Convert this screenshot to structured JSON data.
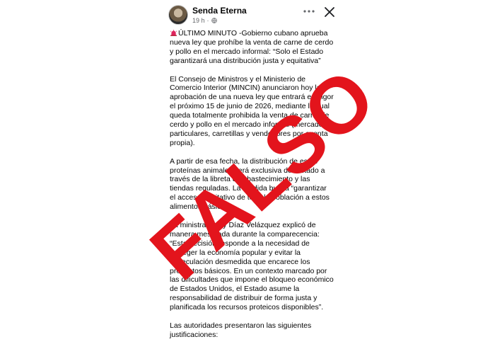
{
  "post": {
    "author": "Senda Eterna",
    "time": "19 h",
    "separator": "·",
    "headline_prefix": "🚨",
    "paragraphs": [
      "ÚLTIMO MINUTO -Gobierno cubano aprueba nueva ley que prohíbe la venta de carne de cerdo y pollo en el mercado informal: “Solo el Estado garantizará una distribución justa y equitativa”",
      "El Consejo de Ministros y el Ministerio de Comercio Interior (MINCIN) anunciaron hoy la aprobación de una nueva ley que entrará en vigor el próximo 15 de junio de 2026, mediante la cual queda totalmente prohibida la venta de carne de cerdo y pollo en el mercado informal (mercados particulares, carretillas y vendedores por cuenta propia).",
      "A partir de esa fecha, la distribución de estas proteínas animales será exclusiva del Estado a través de la libreta de abastecimiento y las tiendas reguladas. La medida busca “garantizar el acceso equitativo de toda la población a estos alimentos básicos”.",
      "La ministra Betsy Díaz Velázquez explicó de manera mesurada durante la comparecencia: “Esta decisión responde a la necesidad de proteger la economía popular y evitar la especulación desmedida que encarece los productos básicos. En un contexto marcado por las dificultades que impone el bloqueo económico de Estados Unidos, el Estado asume la responsabilidad de distribuir de forma justa y planificada los recursos proteicos disponibles”.",
      "Las autoridades presentaron las siguientes justificaciones:"
    ]
  },
  "stamp": {
    "text": "FALSO",
    "color": "#e3141c"
  },
  "icons": {
    "more": "more-horizontal-icon",
    "close": "close-icon",
    "globe": "globe-icon",
    "siren": "siren-icon"
  }
}
